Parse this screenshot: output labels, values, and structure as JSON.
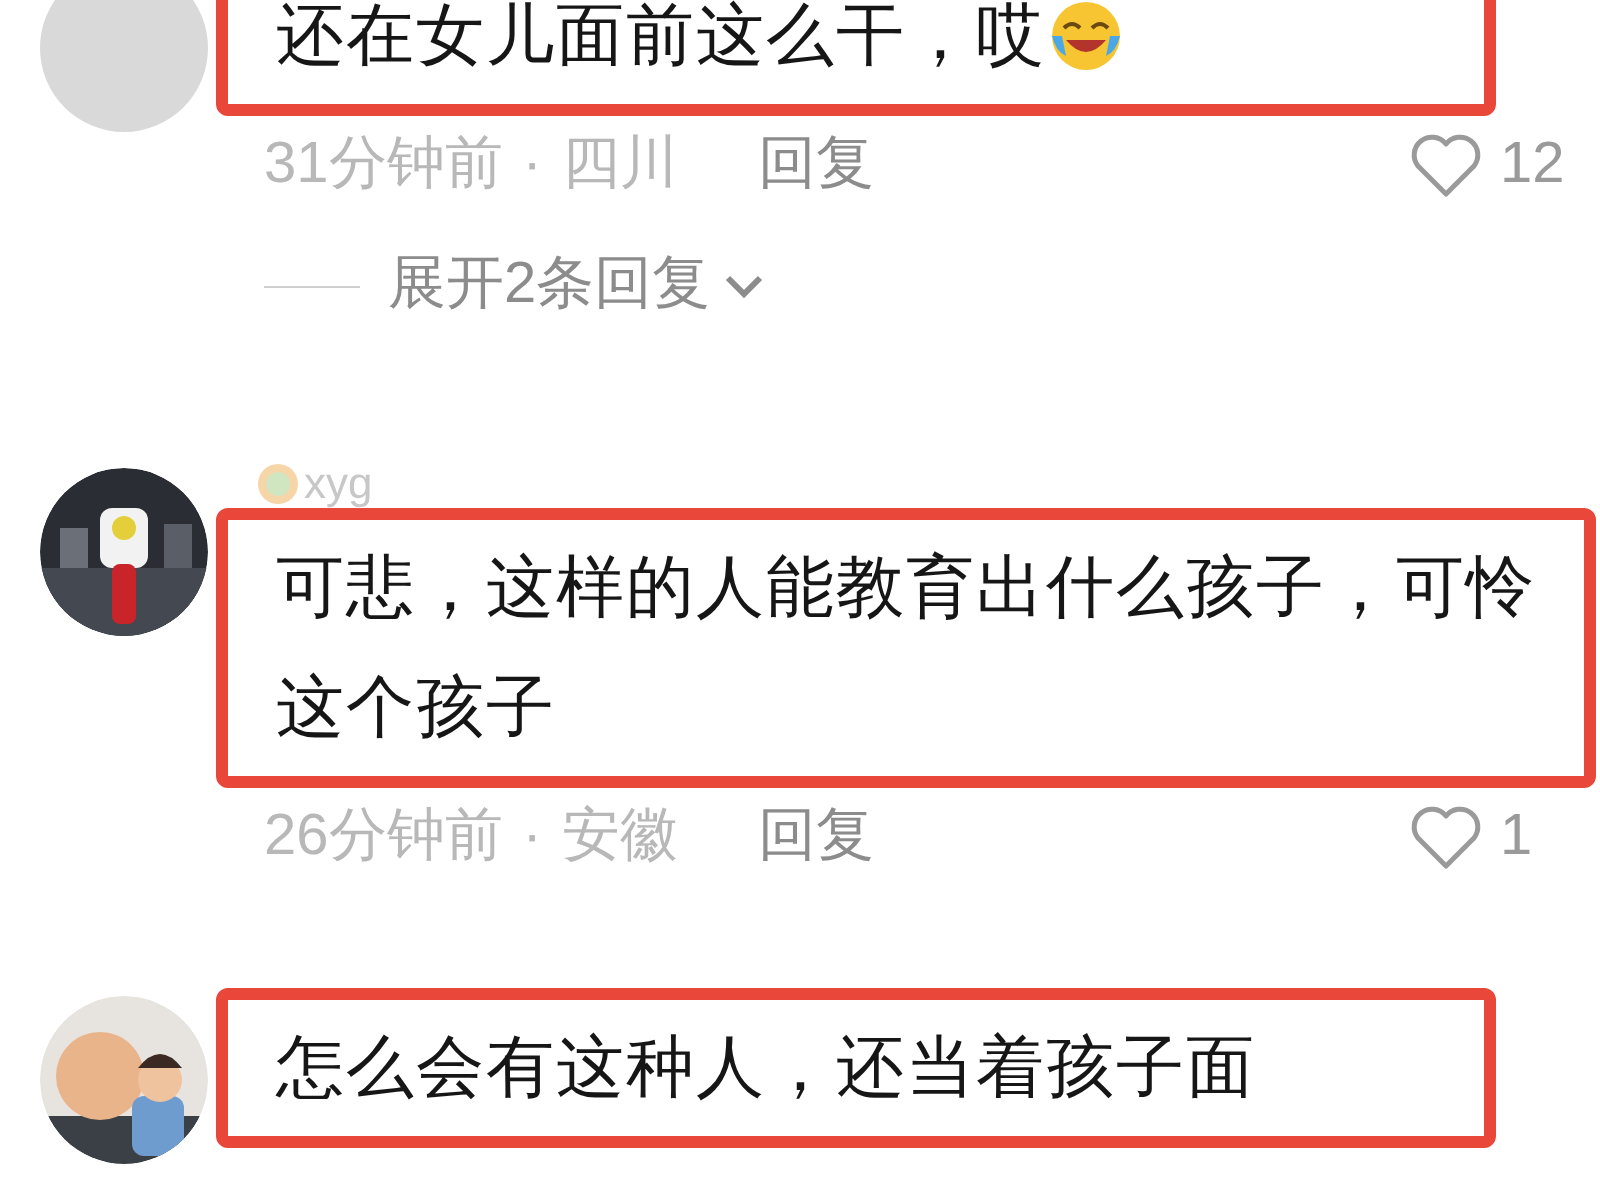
{
  "comments": [
    {
      "avatar": {
        "kind": "plain"
      },
      "text": "还在女儿面前这么干，哎",
      "has_emoji": true,
      "time": "31分钟前",
      "separator": "·",
      "location": "四川",
      "reply": "回复",
      "likes": "12",
      "expand": "展开2条回复"
    },
    {
      "username": "xyg",
      "text": "可悲，这样的人能教育出什么孩子，可怜这个孩子",
      "time": "26分钟前",
      "separator": "·",
      "location": "安徽",
      "reply": "回复",
      "likes": "1"
    },
    {
      "text": "怎么会有这种人，还当着孩子面"
    }
  ]
}
